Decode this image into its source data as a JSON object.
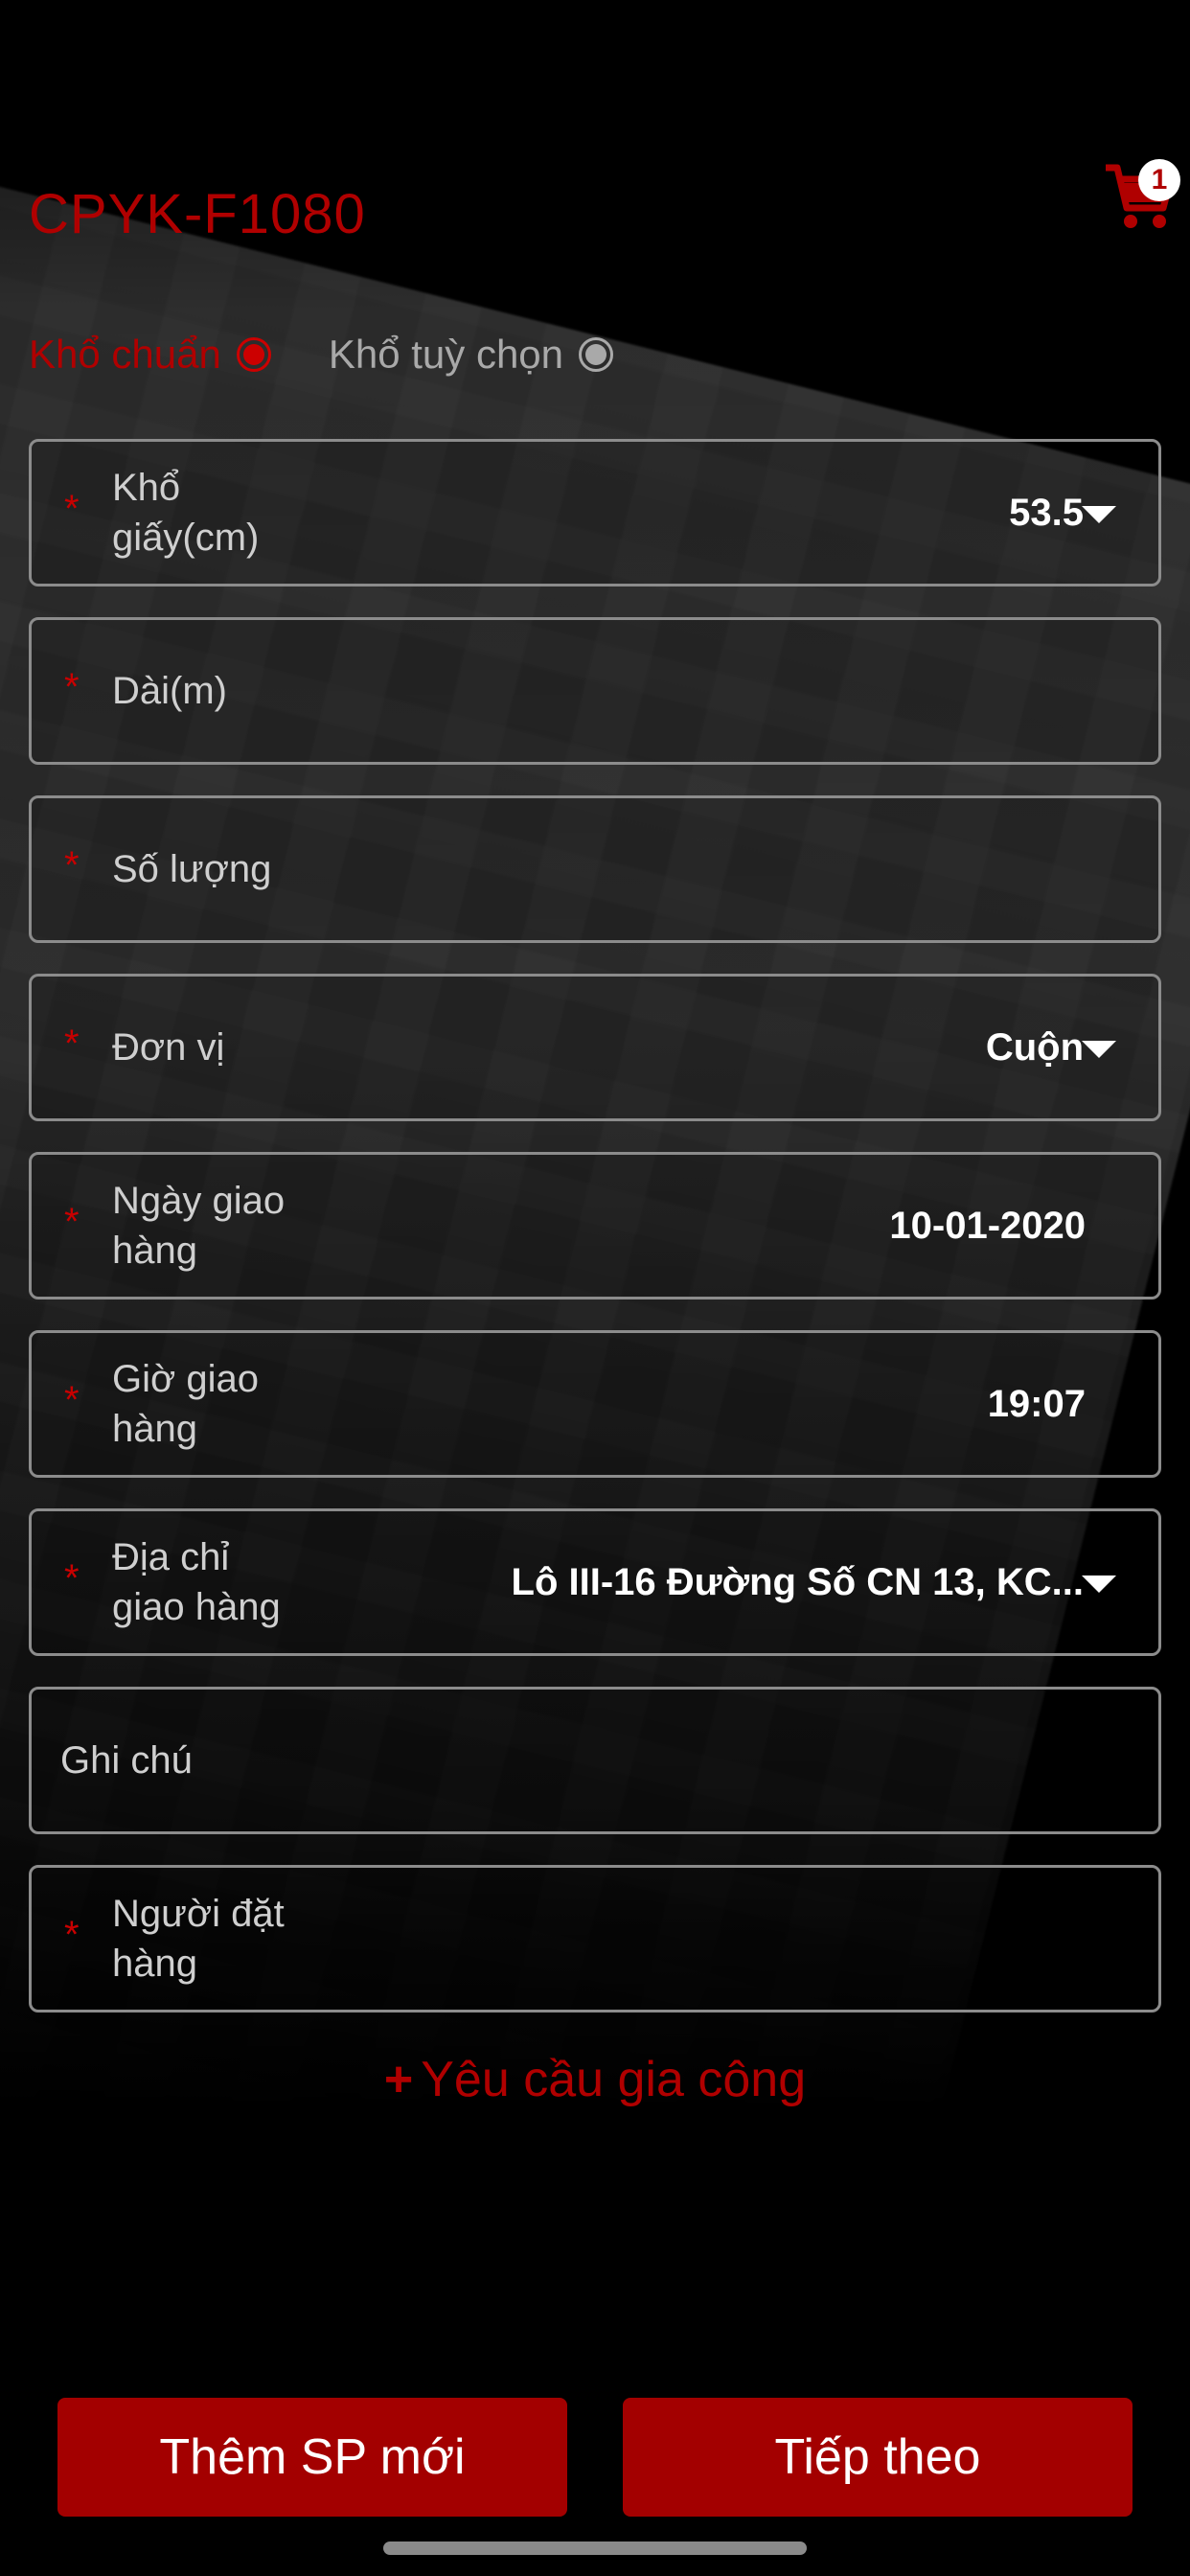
{
  "header": {
    "title": "CPYK-F1080",
    "cart_badge_count": "1",
    "cart_icon": "cart-icon"
  },
  "paper_size": {
    "options": [
      {
        "label": "Khổ chuẩn",
        "selected": true
      },
      {
        "label": "Khổ tuỳ chọn",
        "selected": false
      }
    ]
  },
  "form": {
    "paper_width": {
      "label": "Khổ\ngiấy(cm)",
      "value": "53.5",
      "required": true
    },
    "length": {
      "label": "Dài(m)",
      "value": "",
      "required": true
    },
    "quantity": {
      "label": "Số lượng",
      "value": "",
      "required": true
    },
    "unit": {
      "label": "Đơn vị",
      "value": "Cuộn",
      "required": true
    },
    "delivery_date": {
      "label": "Ngày giao\nhàng",
      "value": "10-01-2020",
      "required": true
    },
    "delivery_time": {
      "label": "Giờ giao\nhàng",
      "value": "19:07",
      "required": true
    },
    "delivery_address": {
      "label": "Địa chỉ\ngiao hàng",
      "value": "Lô III-16 Đường Số CN 13, KC...",
      "required": true
    },
    "note": {
      "label": "Ghi chú",
      "value": "",
      "required": false
    },
    "orderer": {
      "label": "Người đặt\nhàng",
      "value": "",
      "required": true
    }
  },
  "actions": {
    "processing_request": "Yêu cầu gia công",
    "processing_plus": "+",
    "add_product": "Thêm SP mới",
    "next": "Tiếp theo"
  },
  "colors": {
    "accent": "#b00000",
    "button": "#a30000",
    "border": "#8c8c8c"
  }
}
